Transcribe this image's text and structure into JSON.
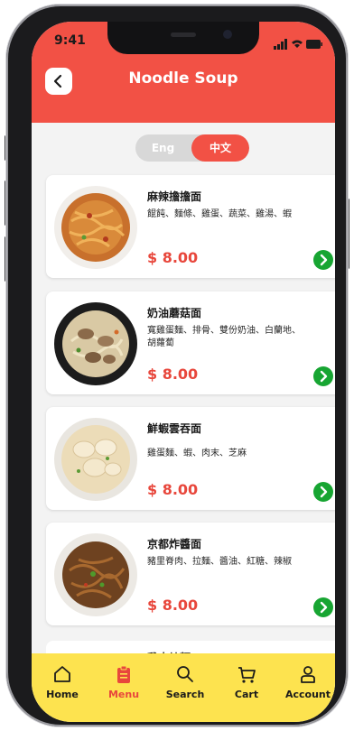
{
  "status": {
    "time": "9:41"
  },
  "header": {
    "title": "Noodle Soup"
  },
  "language": {
    "options": [
      "Eng",
      "中文"
    ],
    "selected": "中文"
  },
  "menu_items": [
    {
      "name": "麻辣擔擔面",
      "description": "餛飩、麵條、雞蛋、蔬菜、雞湯、蝦",
      "price": "$ 8.00"
    },
    {
      "name": "奶油蘑菇面",
      "description": "寬雞蛋麵、排骨、雙份奶油、白蘭地、胡蘿蔔",
      "price": "$ 8.00"
    },
    {
      "name": "鮮蝦雲吞面",
      "description": "雞蛋麵、蝦、肉末、芝麻",
      "price": "$ 8.00"
    },
    {
      "name": "京都炸醬面",
      "description": "豬里脊肉、拉麵、醬油、紅糖、辣椒",
      "price": "$ 8.00"
    },
    {
      "name": "雞肉炒麵",
      "description": "",
      "price": ""
    }
  ],
  "nav": {
    "items": [
      {
        "label": "Home",
        "icon": "home-icon"
      },
      {
        "label": "Menu",
        "icon": "clipboard-icon"
      },
      {
        "label": "Search",
        "icon": "search-icon"
      },
      {
        "label": "Cart",
        "icon": "cart-icon"
      },
      {
        "label": "Account",
        "icon": "person-icon"
      }
    ],
    "active": "Menu"
  },
  "colors": {
    "brand_red": "#f25145",
    "price_red": "#e8473c",
    "nav_yellow": "#fde34f",
    "go_green": "#17a532"
  }
}
